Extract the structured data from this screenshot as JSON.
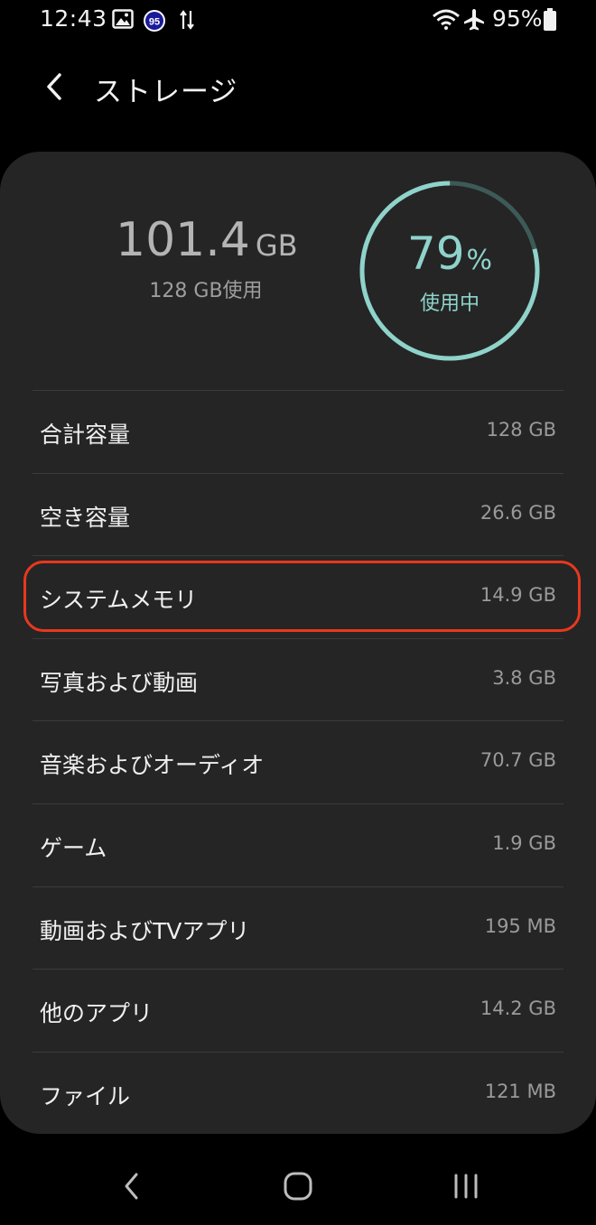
{
  "status_bar": {
    "time": "12:43",
    "badge_number": "95",
    "battery": "95%",
    "icons": [
      "gallery-icon",
      "badge-95-icon",
      "data-transfer-icon",
      "wifi-icon",
      "airplane-icon",
      "battery-icon"
    ]
  },
  "header": {
    "title": "ストレージ",
    "back_icon": "chevron-left-icon"
  },
  "summary": {
    "used_value": "101.4",
    "used_unit": "GB",
    "total_text": "128 GB使用",
    "percent_value": "79",
    "percent_sign": "%",
    "percent_label": "使用中",
    "usage_fraction": 0.79,
    "colors": {
      "ring_used": "#8fd3cb",
      "ring_free": "#3d5a57",
      "highlight": "#e8381e"
    }
  },
  "rows": [
    {
      "label": "合計容量",
      "value": "128 GB"
    },
    {
      "label": "空き容量",
      "value": "26.6 GB"
    },
    {
      "label": "システムメモリ",
      "value": "14.9 GB"
    },
    {
      "label": "写真および動画",
      "value": "3.8 GB"
    },
    {
      "label": "音楽およびオーディオ",
      "value": "70.7 GB"
    },
    {
      "label": "ゲーム",
      "value": "1.9 GB"
    },
    {
      "label": "動画およびTVアプリ",
      "value": "195 MB"
    },
    {
      "label": "他のアプリ",
      "value": "14.2 GB"
    },
    {
      "label": "ファイル",
      "value": "121 MB"
    }
  ],
  "nav_bar": {
    "icons": [
      "nav-back-icon",
      "nav-home-icon",
      "nav-recents-icon"
    ]
  }
}
